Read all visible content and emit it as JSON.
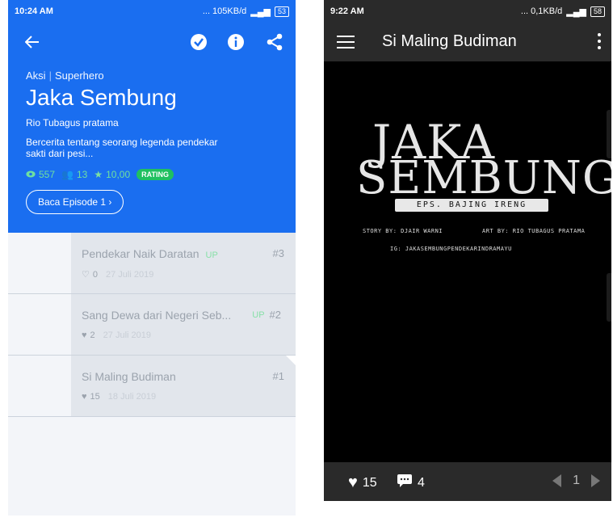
{
  "left": {
    "status": {
      "time": "10:24 AM",
      "network": "... 105KB/d",
      "battery": "53"
    },
    "header": {
      "genre": "Aksi",
      "subgenre": "Superhero",
      "title": "Jaka Sembung",
      "author": "Rio Tubagus pratama",
      "description": "Bercerita tentang seorang legenda pendekar sakti dari pesi...",
      "views": "557",
      "likes": "13",
      "rating_value": "10,00",
      "rating_badge": "RATING",
      "read_button": "Baca Episode 1 ›"
    },
    "episodes": [
      {
        "title": "Pendekar Naik Daratan",
        "up": "UP",
        "number": "#3",
        "likes": "0",
        "date": "27 Juli 2019",
        "liked": false
      },
      {
        "title": "Sang Dewa dari Negeri Seb...",
        "up": "UP",
        "number": "#2",
        "likes": "2",
        "date": "27 Juli 2019",
        "liked": true
      },
      {
        "title": "Si Maling Budiman",
        "up": "",
        "number": "#1",
        "likes": "15",
        "date": "18 Juli 2019",
        "liked": true
      }
    ]
  },
  "right": {
    "status": {
      "time": "9:22 AM",
      "network": "... 0,1KB/d",
      "battery": "58"
    },
    "header": {
      "title": "Si Maling Budiman"
    },
    "comic": {
      "logo_line1": "JAKA",
      "logo_line2": "SEMBUNG",
      "episode_tag": "EPS. BAJING IRENG",
      "story_credit": "STORY BY: DJAIR WARNI",
      "art_credit": "ART BY: RIO TUBAGUS PRATAMA",
      "ig_credit": "IG: JAKASEMBUNGPENDEKARINDRAMAYU"
    },
    "footer": {
      "likes": "15",
      "comments": "4",
      "page": "1"
    }
  },
  "colors": {
    "brand_blue": "#1a6ef0",
    "rating_green": "#20c060",
    "dark_bar": "#2a2a2a"
  }
}
